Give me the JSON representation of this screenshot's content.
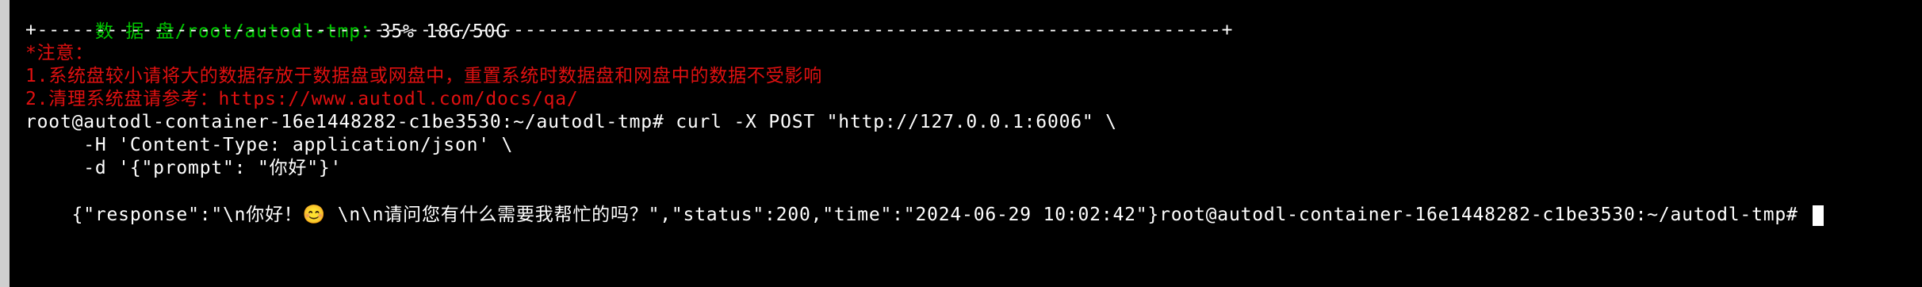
{
  "terminal": {
    "line0": {
      "label": "  数 据 盘/root/autodl-tmp：",
      "value": "35% 18G/50G"
    },
    "line1": "+------------------------------------------------------------------------------------------------------+",
    "line2": "*注意：",
    "line3": "1.系统盘较小请将大的数据存放于数据盘或网盘中，重置系统时数据盘和网盘中的数据不受影响",
    "line4": "2.清理系统盘请参考：https://www.autodl.com/docs/qa/",
    "line5": "root@autodl-container-16e1448282-c1be3530:~/autodl-tmp# curl -X POST \"http://127.0.0.1:6006\" \\",
    "line6": "     -H 'Content-Type: application/json' \\",
    "line7": "     -d '{\"prompt\": \"你好\"}'",
    "line8": {
      "response": "{\"response\":\"\\n你好！😊 \\n\\n请问您有什么需要我帮忙的吗？\",\"status\":200,\"time\":\"2024-06-29 10:02:42\"}",
      "prompt": "root@autodl-container-16e1448282-c1be3530:~/autodl-tmp# "
    }
  },
  "colors": {
    "background": "#000000",
    "text": "#ffffff",
    "accent_green": "#00c800",
    "warning_red": "#e01010",
    "left_rail": "#cfcfcf"
  }
}
